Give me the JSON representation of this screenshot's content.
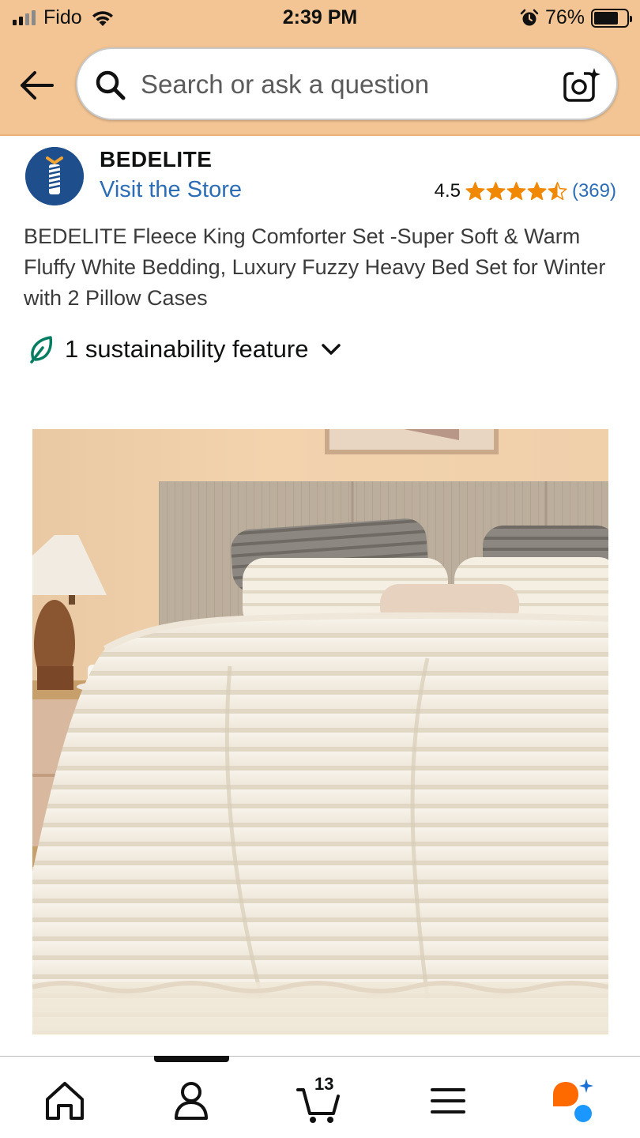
{
  "status_bar": {
    "carrier": "Fido",
    "time": "2:39 PM",
    "battery_percent": "76%",
    "battery_level": 0.76,
    "icons": [
      "signal-icon",
      "wifi-icon",
      "alarm-icon",
      "battery-icon"
    ]
  },
  "header": {
    "back_icon": "back-arrow-icon",
    "search": {
      "placeholder": "Search or ask a question",
      "value": ""
    },
    "camera_icon": "camera-search-icon"
  },
  "brand": {
    "name": "BEDELITE",
    "store_link": "Visit the Store"
  },
  "rating": {
    "value": "4.5",
    "stars": 4.5,
    "count": "(369)"
  },
  "product": {
    "title": "BEDELITE Fleece King Comforter Set -Super Soft & Warm Fluffy White Bedding, Luxury Fuzzy Heavy Bed Set for Winter with 2 Pillow Cases"
  },
  "sustainability": {
    "label": "1 sustainability feature"
  },
  "bottom_nav": {
    "items": [
      "home-icon",
      "account-icon",
      "cart-icon",
      "menu-icon",
      "rufus-icon"
    ],
    "cart_count": "13"
  },
  "colors": {
    "header_band": "#f3c594",
    "link": "#2d6db5",
    "star": "#f08804",
    "leaf": "#067d62",
    "rufus_orange": "#ff6a00",
    "rufus_blue": "#1a98ff"
  }
}
